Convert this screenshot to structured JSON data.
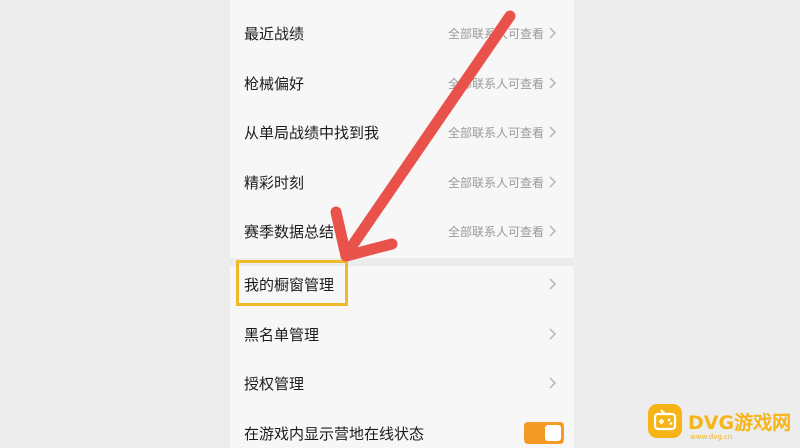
{
  "settings": {
    "rows": [
      {
        "label": "最近战绩",
        "value": "全部联系人可查看"
      },
      {
        "label": "枪械偏好",
        "value": "全部联系人可查看"
      },
      {
        "label": "从单局战绩中找到我",
        "value": "全部联系人可查看"
      },
      {
        "label": "精彩时刻",
        "value": "全部联系人可查看"
      },
      {
        "label": "赛季数据总结",
        "value": "全部联系人可查看"
      },
      {
        "label": "我的橱窗管理"
      },
      {
        "label": "黑名单管理"
      },
      {
        "label": "授权管理"
      },
      {
        "label": "在游戏内显示营地在线状态",
        "toggle_on": true
      }
    ]
  },
  "annotation": {
    "arrow_color": "#e8524a",
    "highlight_color": "#f0b92a",
    "highlighted_item": "我的橱窗管理"
  },
  "watermark": {
    "brand": "DVG游戏网",
    "domain": "www.dvg.cn",
    "color": "#f6b417",
    "icon": "gamepad-icon"
  },
  "colors": {
    "toggle_on": "#f39b26"
  }
}
